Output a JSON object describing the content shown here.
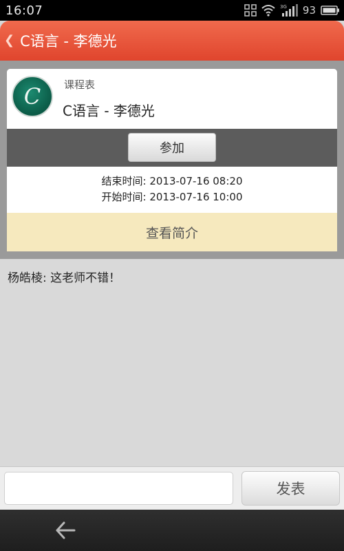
{
  "status_bar": {
    "time": "16:07",
    "network_label": "3G",
    "battery_percent": "93",
    "icons": [
      "scan-icon",
      "wifi-icon",
      "signal-icon",
      "battery-icon"
    ]
  },
  "header": {
    "back_glyph": "❮",
    "title": "C语言 - 李德光"
  },
  "course": {
    "avatar_letter": "C",
    "subtitle": "课程表",
    "title": "C语言 - 李德光",
    "join_label": "参加",
    "end_time": "结束时间: 2013-07-16 08:20",
    "start_time": "开始时间: 2013-07-16 10:00",
    "intro_label": "查看简介"
  },
  "comments": [
    {
      "text": "杨皓棱: 这老师不错！"
    }
  ],
  "input_bar": {
    "value": "",
    "placeholder": "",
    "send_label": "发表"
  },
  "nav": {
    "back_icon": "back-arrow-icon"
  },
  "colors": {
    "header_red": "#e34a30",
    "intro_yellow": "#f6e9be",
    "avatar_green": "#0f6b54",
    "join_band_gray": "#5c5c5c"
  }
}
